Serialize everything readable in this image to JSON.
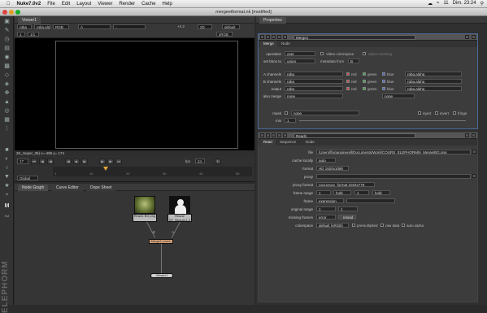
{
  "menubar": {
    "app": "Nuke7.0v2",
    "items": [
      "File",
      "Edit",
      "Layout",
      "Viewer",
      "Render",
      "Cache",
      "Help"
    ],
    "status_right": [
      "11",
      "Dim. 23:24"
    ]
  },
  "window": {
    "title": "mergeetformat.nk [modified]"
  },
  "viewer": {
    "tab": "Viewer1",
    "channels": "rgba",
    "alpha": "rgba.alpha",
    "colorspace": "RGB",
    "input_a": "A",
    "input_b": "-",
    "gain_label": "+4.2",
    "mode": "2D",
    "zoom": "default",
    "lut": "sRGB",
    "frame_value": "1",
    "ratio": "1/1",
    "status": "2K_Super_35) x=-495 y= 174"
  },
  "timeline": {
    "frame": "17",
    "fps_label": "fps",
    "fps": "24",
    "global": "Global",
    "ticks": [
      "1",
      "10",
      "20",
      "30",
      "40",
      "50"
    ]
  },
  "nodegraph": {
    "tabs": [
      "Node Graph",
      "Curve Editor",
      "Dope Sheet"
    ],
    "nodes": {
      "read1": "Read1\nBG.png",
      "read2": "Read2\nSF_Beauty.1.0",
      "merge": "Merge1 (over)",
      "viewer": "Viewer1"
    },
    "wire_labels": {
      "a": "A",
      "b": "B"
    }
  },
  "properties": {
    "tab": "Properties",
    "merge": {
      "name": "Merge1",
      "tabs": [
        "Merge",
        "Node"
      ],
      "operation_label": "operation",
      "operation": "over",
      "video_colorspace": "Video colorspace",
      "alpha_masking": "alpha masking",
      "bbox_label": "set bbox to",
      "bbox": "union",
      "metadata_label": "metadata from",
      "metadata": "B",
      "a_channels_label": "A channels",
      "a_channels": "rgba",
      "b_channels_label": "B channels",
      "b_channels": "rgba",
      "output_label": "output",
      "output": "rgba",
      "also_merge_label": "also merge",
      "also_merge": "none",
      "also_merge_b": "none",
      "color_labels": [
        "red",
        "green",
        "blue"
      ],
      "alpha_field": "rgba.alpha",
      "mask_label": "mask",
      "mask": "none",
      "inject": "inject",
      "invert": "invert",
      "fringe": "fringe",
      "mix_label": "mix",
      "mix": "1"
    },
    "read": {
      "name": "Read1",
      "tabs": [
        "Read",
        "Sequence",
        "Node"
      ],
      "file_label": "file",
      "file": "/Users/florianginerell/Documents/Work/COURS_ELEPHORM/6_Merge/BG.png",
      "cache_label": "cache locally",
      "cache": "auto",
      "format_label": "format",
      "format": "HD 1920x1080",
      "proxy_label": "proxy",
      "proxy": "",
      "proxy_format_label": "proxy format",
      "proxy_format": "root.proxy_format 1024x778",
      "frame_range_label": "frame range",
      "frame_range_start": "1",
      "frame_range_mode1": "hold",
      "frame_range_end": "1",
      "frame_range_mode2": "hold",
      "frame_label": "frame",
      "frame": "expression",
      "original_range_label": "original range",
      "original_start": "1",
      "original_end": "1",
      "missing_label": "missing frames",
      "missing": "error",
      "reload": "reload",
      "colorspace_label": "colorspace",
      "colorspace": "default (sRGB)",
      "premultiplied": "premultiplied",
      "raw_data": "raw data",
      "auto_alpha": "auto alpha"
    }
  },
  "brand": "ELEPHORM",
  "colors": {
    "accent_selection": "#4a6a9a",
    "merge_node": "#d9a47a",
    "viewer_node": "#cccccc",
    "read_node": "#bbbbbb"
  }
}
